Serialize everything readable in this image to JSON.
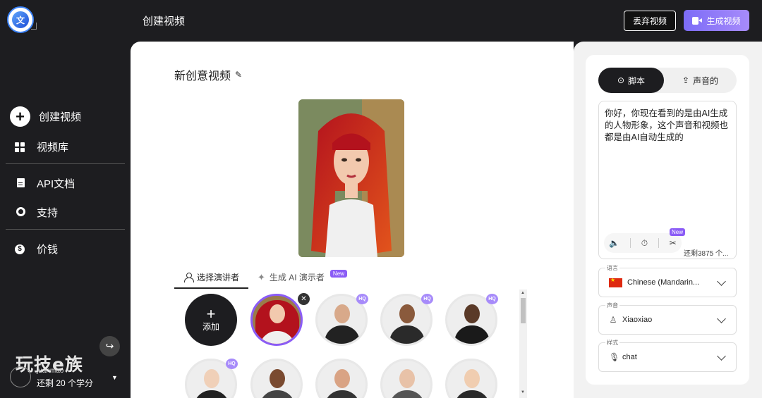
{
  "header": {
    "page_title": "创建视频",
    "discard_label": "丢弃视频",
    "generate_label": "生成视频"
  },
  "sidebar": {
    "items": [
      {
        "label": "创建视频",
        "icon": "plus-circle-icon"
      },
      {
        "label": "视频库",
        "icon": "grid-icon"
      },
      {
        "label": "API文档",
        "icon": "document-icon"
      },
      {
        "label": "支持",
        "icon": "lifebuoy-icon"
      },
      {
        "label": "价钱",
        "icon": "dollar-icon"
      }
    ],
    "watermark": "玩技e族",
    "user": {
      "name": "juanmao",
      "credits": "还剩 20 个学分"
    }
  },
  "main": {
    "video_title": "新创意视频",
    "tabs": [
      {
        "label": "选择演讲者"
      },
      {
        "label": "生成 AI 演示者",
        "badge": "New"
      }
    ],
    "add_label": "添加",
    "plus": "+",
    "hq_badge": "HQ",
    "close_glyph": "✕"
  },
  "right_panel": {
    "tabs": [
      {
        "label": "脚本"
      },
      {
        "label": "声音的"
      }
    ],
    "script_text": "你好，你现在看到的是由AI生成的人物形象，这个声音和视频也都是由AI自动生成的",
    "tools_new_badge": "New",
    "char_count": "还剩3875 个...",
    "language": {
      "label": "语言",
      "value": "Chinese (Mandarin..."
    },
    "voice": {
      "label": "声音",
      "value": "Xiaoxiao"
    },
    "style": {
      "label": "样式",
      "value": "chat"
    }
  },
  "colors": {
    "dark_bg": "#1d1d20",
    "accent_purple": "#8b5cf6",
    "generate_gradient_start": "#7c6cf7",
    "generate_gradient_end": "#a78bfa"
  }
}
